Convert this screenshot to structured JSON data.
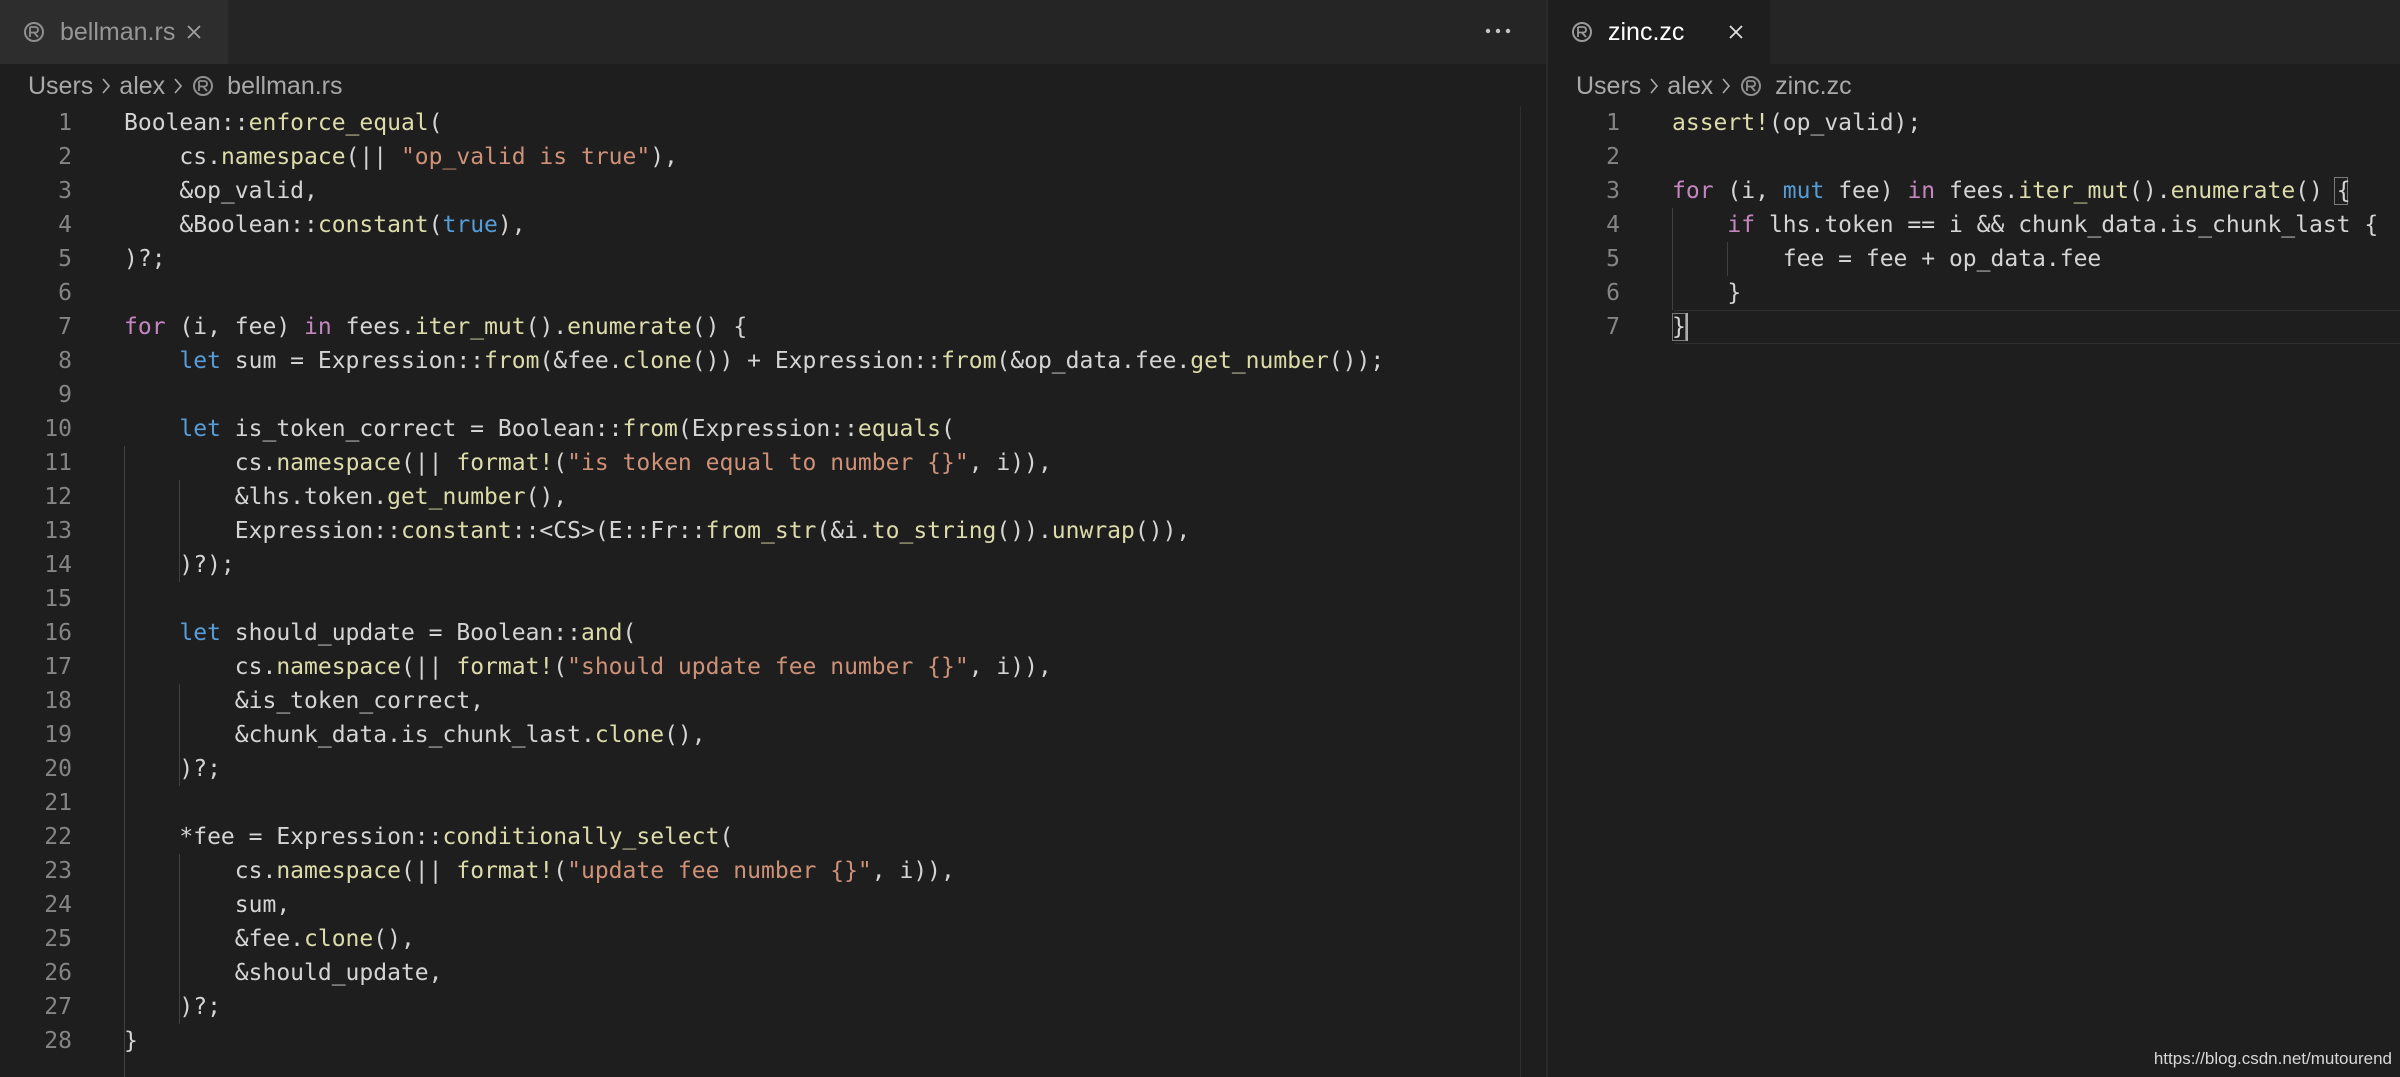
{
  "left_editor": {
    "tab": {
      "label": "bellman.rs",
      "icon": "rust-file-icon"
    },
    "more_actions_icon": "ellipsis-icon",
    "breadcrumb": [
      "Users",
      "alex",
      "bellman.rs"
    ],
    "lines": [
      [
        [
          "tx",
          "Boolean::"
        ],
        [
          "fn",
          "enforce_equal"
        ],
        [
          "tx",
          "("
        ]
      ],
      [
        [
          "tx",
          "    cs."
        ],
        [
          "fn",
          "namespace"
        ],
        [
          "tx",
          "(|| "
        ],
        [
          "str",
          "\"op_valid is true\""
        ],
        [
          "tx",
          "),"
        ]
      ],
      [
        [
          "tx",
          "    &op_valid,"
        ]
      ],
      [
        [
          "tx",
          "    &Boolean::"
        ],
        [
          "fn",
          "constant"
        ],
        [
          "tx",
          "("
        ],
        [
          "st",
          "true"
        ],
        [
          "tx",
          "),"
        ]
      ],
      [
        [
          "tx",
          ")?;"
        ]
      ],
      [],
      [
        [
          "kw",
          "for"
        ],
        [
          "tx",
          " (i, fee) "
        ],
        [
          "kw",
          "in"
        ],
        [
          "tx",
          " fees."
        ],
        [
          "fn",
          "iter_mut"
        ],
        [
          "tx",
          "()."
        ],
        [
          "fn",
          "enumerate"
        ],
        [
          "tx",
          "() {"
        ]
      ],
      [
        [
          "tx",
          "    "
        ],
        [
          "st",
          "let"
        ],
        [
          "tx",
          " sum = Expression::"
        ],
        [
          "fn",
          "from"
        ],
        [
          "tx",
          "(&fee."
        ],
        [
          "fn",
          "clone"
        ],
        [
          "tx",
          "()) + Expression::"
        ],
        [
          "fn",
          "from"
        ],
        [
          "tx",
          "(&op_data.fee."
        ],
        [
          "fn",
          "get_number"
        ],
        [
          "tx",
          "());"
        ]
      ],
      [],
      [
        [
          "tx",
          "    "
        ],
        [
          "st",
          "let"
        ],
        [
          "tx",
          " is_token_correct = Boolean::"
        ],
        [
          "fn",
          "from"
        ],
        [
          "tx",
          "(Expression::"
        ],
        [
          "fn",
          "equals"
        ],
        [
          "tx",
          "("
        ]
      ],
      [
        [
          "tx",
          "        cs."
        ],
        [
          "fn",
          "namespace"
        ],
        [
          "tx",
          "(|| "
        ],
        [
          "fn",
          "format!"
        ],
        [
          "tx",
          "("
        ],
        [
          "str",
          "\"is token equal to number {}\""
        ],
        [
          "tx",
          ", i)),"
        ]
      ],
      [
        [
          "tx",
          "        &lhs.token."
        ],
        [
          "fn",
          "get_number"
        ],
        [
          "tx",
          "(),"
        ]
      ],
      [
        [
          "tx",
          "        Expression::"
        ],
        [
          "fn",
          "constant"
        ],
        [
          "tx",
          "::<CS>(E::Fr::"
        ],
        [
          "fn",
          "from_str"
        ],
        [
          "tx",
          "(&i."
        ],
        [
          "fn",
          "to_string"
        ],
        [
          "tx",
          "())."
        ],
        [
          "fn",
          "unwrap"
        ],
        [
          "tx",
          "()),"
        ]
      ],
      [
        [
          "tx",
          "    )?);"
        ]
      ],
      [],
      [
        [
          "tx",
          "    "
        ],
        [
          "st",
          "let"
        ],
        [
          "tx",
          " should_update = Boolean::"
        ],
        [
          "fn",
          "and"
        ],
        [
          "tx",
          "("
        ]
      ],
      [
        [
          "tx",
          "        cs."
        ],
        [
          "fn",
          "namespace"
        ],
        [
          "tx",
          "(|| "
        ],
        [
          "fn",
          "format!"
        ],
        [
          "tx",
          "("
        ],
        [
          "str",
          "\"should update fee number {}\""
        ],
        [
          "tx",
          ", i)),"
        ]
      ],
      [
        [
          "tx",
          "        &is_token_correct,"
        ]
      ],
      [
        [
          "tx",
          "        &chunk_data.is_chunk_last."
        ],
        [
          "fn",
          "clone"
        ],
        [
          "tx",
          "(),"
        ]
      ],
      [
        [
          "tx",
          "    )?;"
        ]
      ],
      [],
      [
        [
          "tx",
          "    *fee = Expression::"
        ],
        [
          "fn",
          "conditionally_select"
        ],
        [
          "tx",
          "("
        ]
      ],
      [
        [
          "tx",
          "        cs."
        ],
        [
          "fn",
          "namespace"
        ],
        [
          "tx",
          "(|| "
        ],
        [
          "fn",
          "format!"
        ],
        [
          "tx",
          "("
        ],
        [
          "str",
          "\"update fee number {}\""
        ],
        [
          "tx",
          ", i)),"
        ]
      ],
      [
        [
          "tx",
          "        sum,"
        ]
      ],
      [
        [
          "tx",
          "        &fee."
        ],
        [
          "fn",
          "clone"
        ],
        [
          "tx",
          "(),"
        ]
      ],
      [
        [
          "tx",
          "        &should_update,"
        ]
      ],
      [
        [
          "tx",
          "    )?;"
        ]
      ],
      [
        [
          "tx",
          "}"
        ]
      ]
    ]
  },
  "right_editor": {
    "tab": {
      "label": "zinc.zc",
      "icon": "zinc-file-icon"
    },
    "breadcrumb": [
      "Users",
      "alex",
      "zinc.zc"
    ],
    "lines": [
      [
        [
          "fn",
          "assert!"
        ],
        [
          "tx",
          "(op_valid);"
        ]
      ],
      [],
      [
        [
          "kw",
          "for"
        ],
        [
          "tx",
          " (i, "
        ],
        [
          "st",
          "mut"
        ],
        [
          "tx",
          " fee) "
        ],
        [
          "kw",
          "in"
        ],
        [
          "tx",
          " fees."
        ],
        [
          "fn",
          "iter_mut"
        ],
        [
          "tx",
          "()."
        ],
        [
          "fn",
          "enumerate"
        ],
        [
          "tx",
          "() {"
        ]
      ],
      [
        [
          "tx",
          "    "
        ],
        [
          "kw",
          "if"
        ],
        [
          "tx",
          " lhs.token == i && chunk_data.is_chunk_last {"
        ]
      ],
      [
        [
          "tx",
          "        fee = fee + op_data.fee"
        ]
      ],
      [
        [
          "tx",
          "    }"
        ]
      ],
      [
        [
          "tx",
          "}"
        ]
      ]
    ]
  },
  "watermark": "https://blog.csdn.net/mutourend",
  "colors": {
    "background": "#1e1e1e",
    "keyword": "#c586c0",
    "storage": "#569cd6",
    "function": "#dcdcaa",
    "string": "#ce9178",
    "text": "#d4d4d4",
    "line_number": "#858585"
  }
}
